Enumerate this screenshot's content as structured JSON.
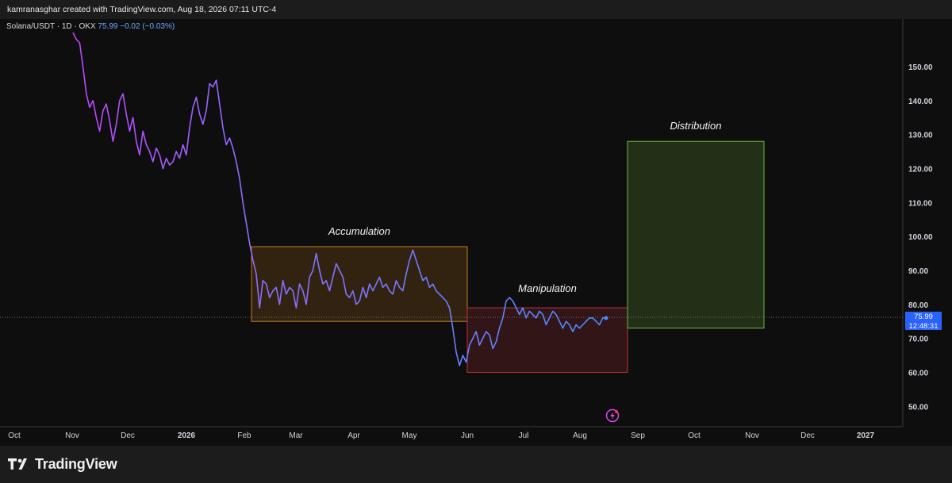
{
  "header": {
    "credit": "kamranasghar created with TradingView.com, Aug 18, 2026 07:11 UTC-4"
  },
  "legend": {
    "symbol": "Solana/USDT · 1D · OKX",
    "price": "75.99",
    "change": "−0.02 (−0.03%)"
  },
  "price_badge": {
    "price": "75.99",
    "countdown": "12:48:31"
  },
  "footer": {
    "brand": "TradingView"
  },
  "colors": {
    "background": "#0e0e0e",
    "line_start": "#c044ff",
    "line_end": "#4a8cff",
    "accumulation": "#c27a1e",
    "manipulation": "#c2303a",
    "distribution": "#6fb83c",
    "badge": "#2962ff"
  },
  "chart_data": {
    "type": "line",
    "series": [
      {
        "values": [
          [
            0,
            160
          ],
          [
            1,
            158
          ],
          [
            2,
            157
          ],
          [
            3,
            150
          ],
          [
            4,
            142
          ],
          [
            5,
            138
          ],
          [
            6,
            140
          ],
          [
            7,
            135
          ],
          [
            8,
            131
          ],
          [
            9,
            137
          ],
          [
            10,
            139
          ],
          [
            11,
            134
          ],
          [
            12,
            128
          ],
          [
            13,
            133
          ],
          [
            14,
            140
          ],
          [
            15,
            142
          ],
          [
            16,
            136
          ],
          [
            17,
            131
          ],
          [
            18,
            135
          ],
          [
            19,
            128
          ],
          [
            20,
            124
          ],
          [
            21,
            131
          ],
          [
            22,
            127
          ],
          [
            23,
            125
          ],
          [
            24,
            122
          ],
          [
            25,
            126
          ],
          [
            26,
            124
          ],
          [
            27,
            120
          ],
          [
            28,
            123
          ],
          [
            29,
            121
          ],
          [
            30,
            122
          ],
          [
            31,
            125
          ],
          [
            32,
            123
          ],
          [
            33,
            127
          ],
          [
            34,
            124
          ],
          [
            35,
            132
          ],
          [
            36,
            138
          ],
          [
            37,
            141
          ],
          [
            38,
            136
          ],
          [
            39,
            133
          ],
          [
            40,
            137
          ],
          [
            41,
            145
          ],
          [
            42,
            144
          ],
          [
            43,
            146
          ],
          [
            44,
            139
          ],
          [
            45,
            132
          ],
          [
            46,
            127
          ],
          [
            47,
            129
          ],
          [
            48,
            126
          ],
          [
            49,
            122
          ],
          [
            50,
            117
          ],
          [
            51,
            110
          ],
          [
            52,
            104
          ],
          [
            53,
            98
          ],
          [
            54,
            93
          ],
          [
            55,
            89
          ],
          [
            56,
            79
          ],
          [
            57,
            87
          ],
          [
            58,
            86
          ],
          [
            59,
            82
          ],
          [
            60,
            84
          ],
          [
            61,
            85
          ],
          [
            62,
            80
          ],
          [
            63,
            87
          ],
          [
            64,
            83
          ],
          [
            65,
            85
          ],
          [
            66,
            84
          ],
          [
            67,
            79
          ],
          [
            68,
            86
          ],
          [
            69,
            84
          ],
          [
            70,
            80
          ],
          [
            71,
            88
          ],
          [
            72,
            90
          ],
          [
            73,
            95
          ],
          [
            74,
            90
          ],
          [
            75,
            86
          ],
          [
            76,
            87
          ],
          [
            77,
            84
          ],
          [
            78,
            88
          ],
          [
            79,
            92
          ],
          [
            80,
            90
          ],
          [
            81,
            88
          ],
          [
            82,
            83
          ],
          [
            83,
            82
          ],
          [
            84,
            84
          ],
          [
            85,
            80
          ],
          [
            86,
            81
          ],
          [
            87,
            85
          ],
          [
            88,
            82
          ],
          [
            89,
            86
          ],
          [
            90,
            84
          ],
          [
            91,
            86
          ],
          [
            92,
            88
          ],
          [
            93,
            85
          ],
          [
            94,
            86
          ],
          [
            95,
            84
          ],
          [
            96,
            83
          ],
          [
            97,
            87
          ],
          [
            98,
            85
          ],
          [
            99,
            84
          ],
          [
            100,
            89
          ],
          [
            101,
            93
          ],
          [
            102,
            96
          ],
          [
            103,
            93
          ],
          [
            104,
            90
          ],
          [
            105,
            87
          ],
          [
            106,
            88
          ],
          [
            107,
            85
          ],
          [
            108,
            86
          ],
          [
            109,
            84
          ],
          [
            110,
            83
          ],
          [
            111,
            82
          ],
          [
            112,
            81
          ],
          [
            113,
            79
          ],
          [
            114,
            73
          ],
          [
            115,
            66
          ],
          [
            116,
            62
          ],
          [
            117,
            65
          ],
          [
            118,
            63
          ],
          [
            119,
            68
          ],
          [
            120,
            70
          ],
          [
            121,
            72
          ],
          [
            122,
            68
          ],
          [
            123,
            70
          ],
          [
            124,
            72
          ],
          [
            125,
            71
          ],
          [
            126,
            67
          ],
          [
            127,
            69
          ],
          [
            128,
            73
          ],
          [
            129,
            76
          ],
          [
            130,
            81
          ],
          [
            131,
            82
          ],
          [
            132,
            81
          ],
          [
            133,
            79
          ],
          [
            134,
            77
          ],
          [
            135,
            79
          ],
          [
            136,
            76
          ],
          [
            137,
            78
          ],
          [
            138,
            77
          ],
          [
            139,
            76
          ],
          [
            140,
            78
          ],
          [
            141,
            77
          ],
          [
            142,
            74
          ],
          [
            143,
            76
          ],
          [
            144,
            78
          ],
          [
            145,
            77
          ],
          [
            146,
            75
          ],
          [
            147,
            73
          ],
          [
            148,
            75
          ],
          [
            149,
            74
          ],
          [
            150,
            72
          ],
          [
            151,
            74
          ],
          [
            152,
            73
          ],
          [
            153,
            74
          ],
          [
            154,
            75
          ],
          [
            155,
            76
          ],
          [
            156,
            76
          ],
          [
            157,
            75
          ],
          [
            158,
            74
          ],
          [
            159,
            76
          ],
          [
            160,
            75.99
          ]
        ]
      }
    ],
    "x_tick_labels": [
      "Oct",
      "Nov",
      "Dec",
      "2026",
      "Feb",
      "Mar",
      "Apr",
      "May",
      "Jun",
      "Jul",
      "Aug",
      "Sep",
      "Oct",
      "Nov",
      "Dec",
      "2027"
    ],
    "y_ticks": [
      50,
      60,
      70,
      80,
      90,
      100,
      110,
      120,
      130,
      140,
      150
    ],
    "y_tick_labels": [
      "50.00",
      "60.00",
      "70.00",
      "80.00",
      "90.00",
      "100.00",
      "110.00",
      "120.00",
      "130.00",
      "140.00",
      "150.00"
    ],
    "ylim": [
      44,
      164
    ],
    "grid": false,
    "annotations": [
      {
        "label": "Accumulation",
        "y_low": 75,
        "y_high": 97,
        "color": "#c27a1e"
      },
      {
        "label": "Manipulation",
        "y_low": 60,
        "y_high": 79,
        "color": "#c2303a"
      },
      {
        "label": "Distribution",
        "y_low": 73,
        "y_high": 128,
        "color": "#6fb83c"
      }
    ],
    "current_price": 75.99
  }
}
